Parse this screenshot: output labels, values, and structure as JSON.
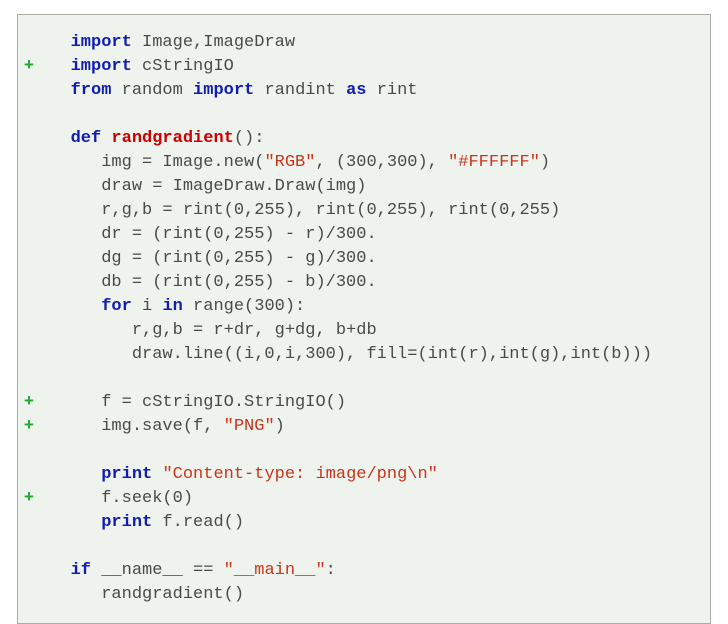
{
  "code": {
    "lines": [
      {
        "marker": "",
        "tokens": [
          {
            "t": "   ",
            "c": null
          },
          {
            "t": "import",
            "c": "kw"
          },
          {
            "t": " Image,ImageDraw",
            "c": null
          }
        ]
      },
      {
        "marker": "+",
        "tokens": [
          {
            "t": "   ",
            "c": null
          },
          {
            "t": "import",
            "c": "kw"
          },
          {
            "t": " cStringIO",
            "c": null
          }
        ]
      },
      {
        "marker": "",
        "tokens": [
          {
            "t": "   ",
            "c": null
          },
          {
            "t": "from",
            "c": "kw"
          },
          {
            "t": " random ",
            "c": null
          },
          {
            "t": "import",
            "c": "kw"
          },
          {
            "t": " randint ",
            "c": null
          },
          {
            "t": "as",
            "c": "kw"
          },
          {
            "t": " rint",
            "c": null
          }
        ]
      },
      {
        "marker": "",
        "tokens": [
          {
            "t": "",
            "c": null
          }
        ]
      },
      {
        "marker": "",
        "tokens": [
          {
            "t": "   ",
            "c": null
          },
          {
            "t": "def",
            "c": "kw"
          },
          {
            "t": " ",
            "c": null
          },
          {
            "t": "randgradient",
            "c": "fn"
          },
          {
            "t": "():",
            "c": null
          }
        ]
      },
      {
        "marker": "",
        "tokens": [
          {
            "t": "      img = Image.new(",
            "c": null
          },
          {
            "t": "\"RGB\"",
            "c": "str"
          },
          {
            "t": ", (300,300), ",
            "c": null
          },
          {
            "t": "\"#FFFFFF\"",
            "c": "str"
          },
          {
            "t": ")",
            "c": null
          }
        ]
      },
      {
        "marker": "",
        "tokens": [
          {
            "t": "      draw = ImageDraw.Draw(img)",
            "c": null
          }
        ]
      },
      {
        "marker": "",
        "tokens": [
          {
            "t": "      r,g,b = rint(0,255), rint(0,255), rint(0,255)",
            "c": null
          }
        ]
      },
      {
        "marker": "",
        "tokens": [
          {
            "t": "      dr = (rint(0,255) - r)/300.",
            "c": null
          }
        ]
      },
      {
        "marker": "",
        "tokens": [
          {
            "t": "      dg = (rint(0,255) - g)/300.",
            "c": null
          }
        ]
      },
      {
        "marker": "",
        "tokens": [
          {
            "t": "      db = (rint(0,255) - b)/300.",
            "c": null
          }
        ]
      },
      {
        "marker": "",
        "tokens": [
          {
            "t": "      ",
            "c": null
          },
          {
            "t": "for",
            "c": "kw"
          },
          {
            "t": " i ",
            "c": null
          },
          {
            "t": "in",
            "c": "kw"
          },
          {
            "t": " range(300):",
            "c": null
          }
        ]
      },
      {
        "marker": "",
        "tokens": [
          {
            "t": "         r,g,b = r+dr, g+dg, b+db",
            "c": null
          }
        ]
      },
      {
        "marker": "",
        "tokens": [
          {
            "t": "         draw.line((i,0,i,300), fill=(int(r),int(g),int(b)))",
            "c": null
          }
        ]
      },
      {
        "marker": "",
        "tokens": [
          {
            "t": "",
            "c": null
          }
        ]
      },
      {
        "marker": "+",
        "tokens": [
          {
            "t": "      f = cStringIO.StringIO()",
            "c": null
          }
        ]
      },
      {
        "marker": "+",
        "tokens": [
          {
            "t": "      img.save(f, ",
            "c": null
          },
          {
            "t": "\"PNG\"",
            "c": "str"
          },
          {
            "t": ")",
            "c": null
          }
        ]
      },
      {
        "marker": "",
        "tokens": [
          {
            "t": "",
            "c": null
          }
        ]
      },
      {
        "marker": "",
        "tokens": [
          {
            "t": "      ",
            "c": null
          },
          {
            "t": "print",
            "c": "kw"
          },
          {
            "t": " ",
            "c": null
          },
          {
            "t": "\"Content-type: image/png\\n\"",
            "c": "str"
          }
        ]
      },
      {
        "marker": "+",
        "tokens": [
          {
            "t": "      f.seek(0)",
            "c": null
          }
        ]
      },
      {
        "marker": "",
        "tokens": [
          {
            "t": "      ",
            "c": null
          },
          {
            "t": "print",
            "c": "kw"
          },
          {
            "t": " f.read()",
            "c": null
          }
        ]
      },
      {
        "marker": "",
        "tokens": [
          {
            "t": "",
            "c": null
          }
        ]
      },
      {
        "marker": "",
        "tokens": [
          {
            "t": "   ",
            "c": null
          },
          {
            "t": "if",
            "c": "kw"
          },
          {
            "t": " __name__ == ",
            "c": null
          },
          {
            "t": "\"__main__\"",
            "c": "str"
          },
          {
            "t": ":",
            "c": null
          }
        ]
      },
      {
        "marker": "",
        "tokens": [
          {
            "t": "      randgradient()",
            "c": null
          }
        ]
      }
    ]
  }
}
